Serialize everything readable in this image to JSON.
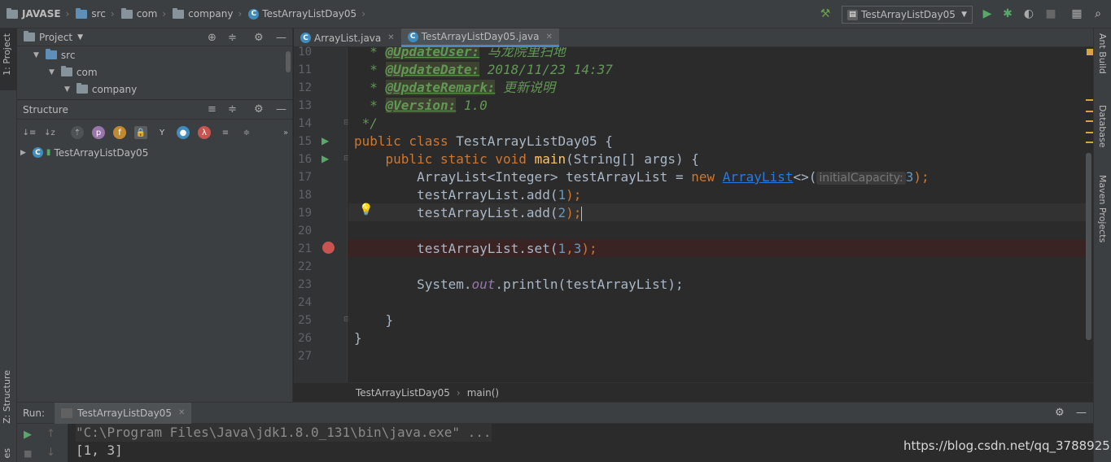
{
  "navbar": {
    "breadcrumbs": [
      "JAVASE",
      "src",
      "com",
      "company",
      "TestArrayListDay05"
    ],
    "run_config": "TestArrayListDay05"
  },
  "left_stripe": {
    "tab_project": "1: Project",
    "tab_structure": "Z: Structure",
    "tab_bottom": "es"
  },
  "right_stripe": {
    "tabs": [
      "Ant Build",
      "Database",
      "Maven Projects"
    ]
  },
  "project": {
    "title": "Project",
    "tree": [
      {
        "label": "src",
        "depth": 1
      },
      {
        "label": "com",
        "depth": 2
      },
      {
        "label": "company",
        "depth": 3
      }
    ]
  },
  "structure": {
    "title": "Structure",
    "root_item": "TestArrayListDay05"
  },
  "editor": {
    "tabs": [
      {
        "label": "ArrayList.java",
        "active": false
      },
      {
        "label": "TestArrayListDay05.java",
        "active": true
      }
    ],
    "line_numbers": [
      "10",
      "11",
      "12",
      "13",
      "14",
      "15",
      "16",
      "17",
      "18",
      "19",
      "20",
      "21",
      "22",
      "23",
      "24",
      "25",
      "26",
      "27"
    ],
    "code": {
      "l10_tag": "@UpdateUser:",
      "l10_text": " 马龙院里扫地",
      "l11_tag": "@UpdateDate:",
      "l11_text": " 2018/11/23 14:37",
      "l12_tag": "@UpdateRemark:",
      "l12_text": " 更新说明",
      "l13_tag": "@Version:",
      "l13_text": " 1.0",
      "l14": " */",
      "l15_kw": "public class ",
      "l15_rest": "TestArrayListDay05 {",
      "l16_kw": "public static void ",
      "l16_fn": "main",
      "l16_rest": "(String[] args) {",
      "l17_a": "ArrayList<Integer> testArrayList = ",
      "l17_kw": "new ",
      "l17_link": "ArrayList",
      "l17_b": "<>(",
      "l17_hint": "initialCapacity:",
      "l17_num": "3",
      "l17_end": ");",
      "l18_a": "testArrayList.add(",
      "l18_num": "1",
      "l18_end": ");",
      "l19_a": "testArrayList.add(",
      "l19_num": "2",
      "l19_end": ");",
      "l21_a": "testArrayList.set(",
      "l21_num1": "1",
      "l21_comma": ",",
      "l21_num2": "3",
      "l21_end": ");",
      "l23_a": "System.",
      "l23_field": "out",
      "l23_b": ".println(testArrayList);",
      "l25": "}",
      "l26": "}"
    },
    "crumbs": [
      "TestArrayListDay05",
      "main()"
    ]
  },
  "run": {
    "label": "Run:",
    "tab": "TestArrayListDay05",
    "console": [
      "\"C:\\Program Files\\Java\\jdk1.8.0_131\\bin\\java.exe\" ...",
      "[1, 3]"
    ]
  },
  "watermark": "https://blog.csdn.net/qq_37889257",
  "colors": {
    "accent": "#4a88c7",
    "keyword": "#cc7832",
    "comment": "#629755",
    "number": "#6897bb",
    "breakpoint": "#c75450"
  }
}
